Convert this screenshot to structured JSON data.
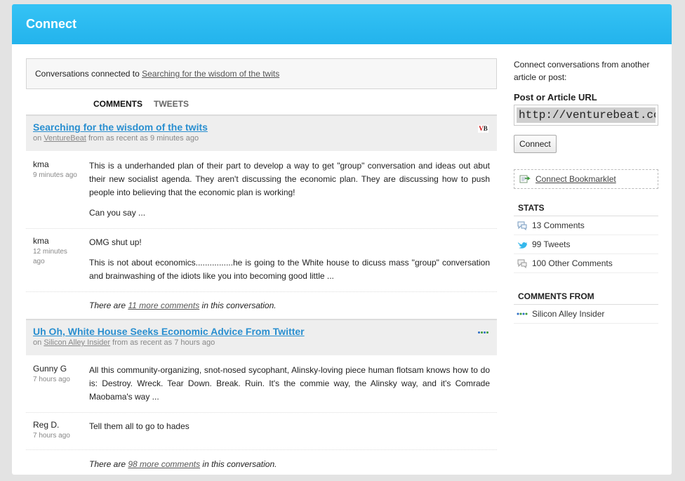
{
  "header": {
    "title": "Connect"
  },
  "conversation": {
    "prefix": "Conversations connected to",
    "link": "Searching for the wisdom of the twits"
  },
  "tabs": [
    "COMMENTS",
    "TWEETS"
  ],
  "articles": [
    {
      "title": "Searching for the wisdom of the twits",
      "meta_on": "on",
      "source": "VentureBeat",
      "meta_suffix": "from as recent as 9 minutes ago",
      "badge": "VB",
      "comments": [
        {
          "author": "kma",
          "time": "9 minutes ago",
          "paragraphs": [
            "This is a underhanded plan of their part to develop a way to get \"group\" conversation and ideas out abut their new socialist agenda. They aren't discussing the economic plan. They are discussing how to push people into believing that the economic plan is working!",
            "Can you say ..."
          ]
        },
        {
          "author": "kma",
          "time": "12 minutes ago",
          "paragraphs": [
            "OMG shut up!",
            "This is not about economics................he is going to the White house to dicuss mass \"group\" conversation and brainwashing of the idiots like you into becoming good little ..."
          ]
        }
      ],
      "more": {
        "pre": "There are",
        "link": "11 more comments",
        "post": "in this conversation."
      }
    },
    {
      "title": "Uh Oh, White House Seeks Economic Advice From Twitter",
      "meta_on": "on",
      "source": "Silicon Alley Insider",
      "meta_suffix": "from as recent as 7 hours ago",
      "comments": [
        {
          "author": "Gunny G",
          "time": "7 hours ago",
          "paragraphs": [
            "All this community-organizing, snot-nosed sycophant, Alinsky-loving piece human flotsam knows how to do is: Destroy. Wreck. Tear Down. Break. Ruin. It's the commie way, the Alinsky way, and it's Comrade Maobama's way ..."
          ]
        },
        {
          "author": "Reg D.",
          "time": "7 hours ago",
          "paragraphs": [
            "Tell them all to go to hades"
          ]
        }
      ],
      "more": {
        "pre": "There are",
        "link": "98 more comments",
        "post": "in this conversation."
      }
    }
  ],
  "sidebar": {
    "intro": "Connect conversations from another article or post:",
    "url_label": "Post or Article URL",
    "url_value": "http://venturebeat.com/",
    "connect_button": "Connect",
    "bookmarklet": "Connect Bookmarklet",
    "stats_title": "STATS",
    "stats": [
      {
        "icon": "comment-bubble-icon",
        "label": "13 Comments"
      },
      {
        "icon": "twitter-bird-icon",
        "label": "99 Tweets"
      },
      {
        "icon": "comment-bubble-icon",
        "label": "100 Other Comments"
      }
    ],
    "from_title": "COMMENTS FROM",
    "from": [
      {
        "icon": "silicon-alley-dots-icon",
        "label": "Silicon Alley Insider"
      }
    ]
  },
  "colors": {
    "header": "#2ab8f0",
    "link": "#2a8fd0",
    "panel": "#eeeeee"
  }
}
